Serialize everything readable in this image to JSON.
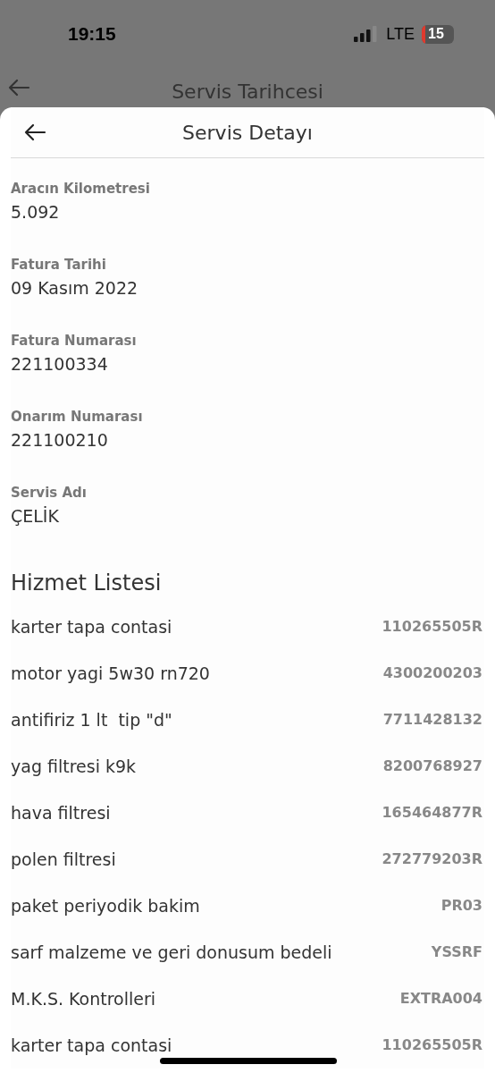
{
  "status_bar": {
    "time": "19:15",
    "network": "LTE",
    "battery": "15"
  },
  "background_screen": {
    "title": "Servis Tarihcesi"
  },
  "sheet": {
    "title": "Servis Detayı"
  },
  "fields": [
    {
      "label": "Aracın Kilometresi",
      "value": "5.092"
    },
    {
      "label": "Fatura Tarihi",
      "value": "09 Kasım 2022"
    },
    {
      "label": "Fatura Numarası",
      "value": "221100334"
    },
    {
      "label": "Onarım Numarası",
      "value": "221100210"
    },
    {
      "label": "Servis Adı",
      "value": "ÇELİK"
    }
  ],
  "service_list": {
    "title": "Hizmet Listesi",
    "items": [
      {
        "name": "karter tapa contasi",
        "code": "110265505R"
      },
      {
        "name": "motor yagi 5w30 rn720",
        "code": "4300200203"
      },
      {
        "name": "antifiriz 1 lt  tip \"d\"",
        "code": "7711428132"
      },
      {
        "name": "yag filtresi k9k",
        "code": "8200768927"
      },
      {
        "name": "hava filtresi",
        "code": "165464877R"
      },
      {
        "name": "polen filtresi",
        "code": "272779203R"
      },
      {
        "name": "paket periyodik bakim",
        "code": "PR03"
      },
      {
        "name": "sarf malzeme ve geri donusum bedeli",
        "code": "YSSRF"
      },
      {
        "name": "M.K.S. Kontrolleri",
        "code": "EXTRA004"
      },
      {
        "name": "karter tapa contasi",
        "code": "110265505R"
      }
    ]
  }
}
